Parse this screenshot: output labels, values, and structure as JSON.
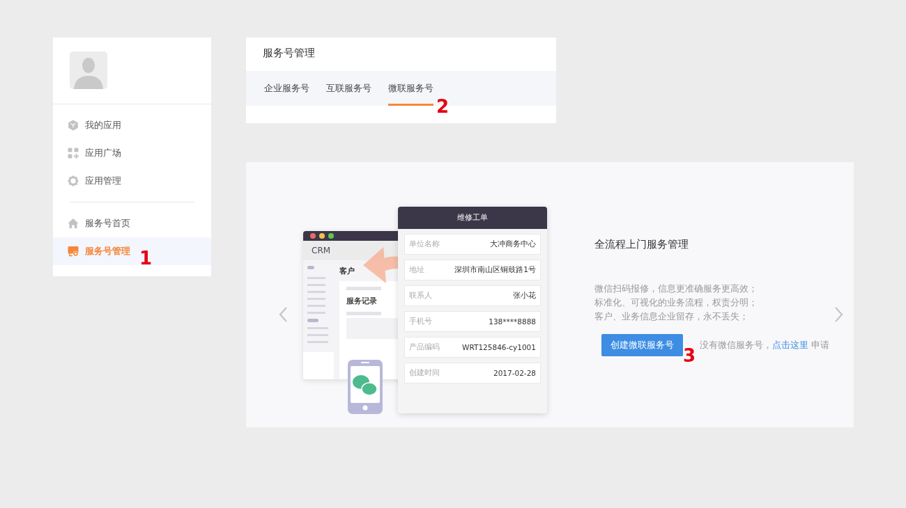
{
  "sidebar": {
    "groups": [
      {
        "items": [
          {
            "label": "我的应用",
            "selected": false
          },
          {
            "label": "应用广场",
            "selected": false
          },
          {
            "label": "应用管理",
            "selected": false
          }
        ]
      },
      {
        "items": [
          {
            "label": "服务号首页",
            "selected": false
          },
          {
            "label": "服务号管理",
            "selected": true,
            "marker": "1"
          }
        ]
      }
    ]
  },
  "header": {
    "title": "服务号管理",
    "tabs": [
      {
        "label": "企业服务号",
        "selected": false
      },
      {
        "label": "互联服务号",
        "selected": false
      },
      {
        "label": "微联服务号",
        "selected": true,
        "marker": "2"
      }
    ]
  },
  "banner": {
    "illustration": {
      "crm": {
        "title": "CRM",
        "section": "客户",
        "subsection": "服务记录"
      },
      "form": {
        "title": "维修工单",
        "rows": [
          {
            "label": "单位名称",
            "value": "大冲商务中心"
          },
          {
            "label": "地址",
            "value": "深圳市南山区铜鼓路1号"
          },
          {
            "label": "联系人",
            "value": "张小花"
          },
          {
            "label": "手机号",
            "value": "138****8888"
          },
          {
            "label": "产品编码",
            "value": "WRT125846-cy1001"
          },
          {
            "label": "创建时间",
            "value": "2017-02-28"
          }
        ]
      }
    },
    "title": "全流程上门服务管理",
    "lines": [
      "微信扫码报修，信息更准确服务更高效；",
      "标准化、可视化的业务流程，权责分明；",
      "客户、业务信息企业留存，永不丢失；"
    ],
    "button": {
      "label": "创建微联服务号",
      "marker": "3"
    },
    "note": {
      "text": "没有微信服务号，",
      "link": "点击这里",
      "suffix": "申请"
    }
  }
}
